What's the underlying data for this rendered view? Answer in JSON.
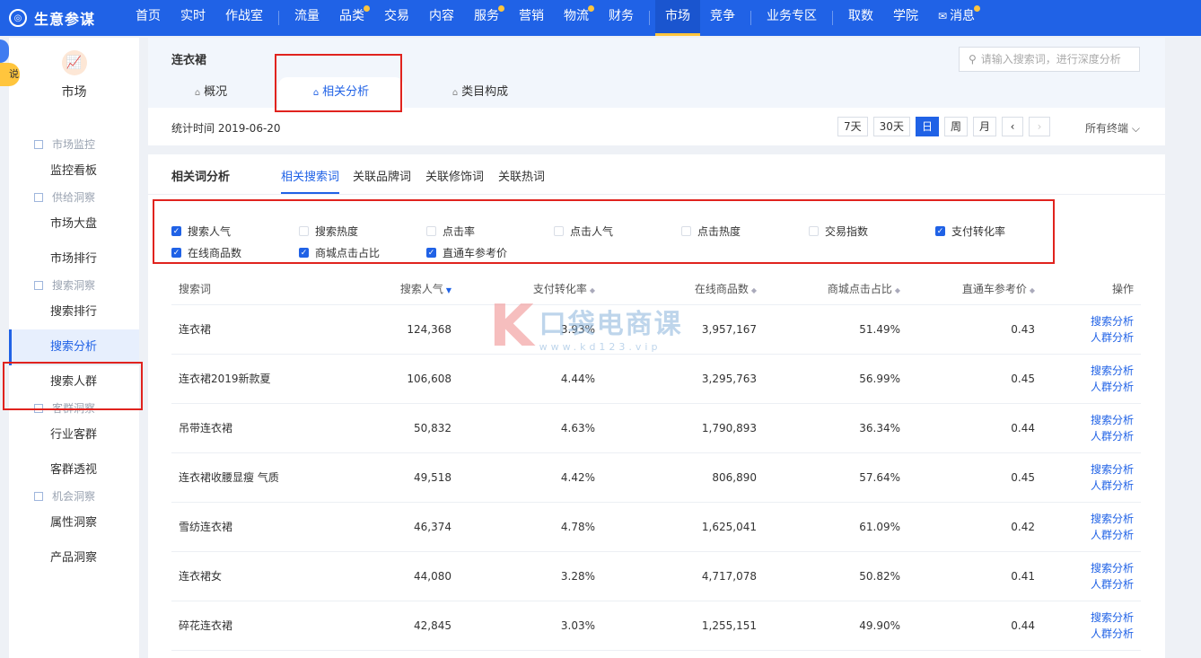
{
  "app": {
    "name": "生意参谋"
  },
  "topnav": {
    "groups": [
      [
        {
          "label": "首页",
          "dot": false
        },
        {
          "label": "实时",
          "dot": false
        },
        {
          "label": "作战室",
          "dot": false
        }
      ],
      [
        {
          "label": "流量",
          "dot": false
        },
        {
          "label": "品类",
          "dot": true
        },
        {
          "label": "交易",
          "dot": false
        },
        {
          "label": "内容",
          "dot": false
        },
        {
          "label": "服务",
          "dot": true
        },
        {
          "label": "营销",
          "dot": false
        },
        {
          "label": "物流",
          "dot": true
        },
        {
          "label": "财务",
          "dot": false
        }
      ],
      [
        {
          "label": "市场",
          "dot": false,
          "active": true
        },
        {
          "label": "竞争",
          "dot": false
        }
      ],
      [
        {
          "label": "业务专区",
          "dot": false
        }
      ],
      [
        {
          "label": "取数",
          "dot": false
        },
        {
          "label": "学院",
          "dot": false
        },
        {
          "label": "消息",
          "dot": true,
          "icon": "mail-icon"
        }
      ]
    ]
  },
  "sidebar": {
    "help_label": "说明",
    "head_label": "市场",
    "head_icon": "market-chart-icon",
    "groups": [
      {
        "title": "市场监控",
        "items": [
          "监控看板"
        ]
      },
      {
        "title": "供给洞察",
        "items": [
          "市场大盘",
          "市场排行"
        ]
      },
      {
        "title": "搜索洞察",
        "items": [
          "搜索排行",
          "搜索分析",
          "搜索人群"
        ]
      },
      {
        "title": "客群洞察",
        "items": [
          "行业客群",
          "客群透视"
        ]
      },
      {
        "title": "机会洞察",
        "items": [
          "属性洞察",
          "产品洞察"
        ]
      }
    ],
    "active_item": "搜索分析"
  },
  "header": {
    "category": "连衣裙",
    "search_placeholder": "请输入搜索词，进行深度分析",
    "tabs": [
      "概况",
      "相关分析",
      "类目构成"
    ],
    "active_tab": "相关分析",
    "stat_time": "统计时间 2019-06-20",
    "date_buttons": [
      "7天",
      "30天",
      "日",
      "周",
      "月"
    ],
    "active_date": "日",
    "terminal": "所有终端"
  },
  "analysis": {
    "title": "相关词分析",
    "subtabs": [
      "相关搜索词",
      "关联品牌词",
      "关联修饰词",
      "关联热词"
    ],
    "active_subtab": "相关搜索词",
    "metrics_row1": [
      {
        "label": "搜索人气",
        "checked": true
      },
      {
        "label": "搜索热度",
        "checked": false
      },
      {
        "label": "点击率",
        "checked": false
      },
      {
        "label": "点击人气",
        "checked": false
      },
      {
        "label": "点击热度",
        "checked": false
      },
      {
        "label": "交易指数",
        "checked": false
      },
      {
        "label": "支付转化率",
        "checked": true
      }
    ],
    "metrics_row2": [
      {
        "label": "在线商品数",
        "checked": true
      },
      {
        "label": "商城点击占比",
        "checked": true
      },
      {
        "label": "直通车参考价",
        "checked": true
      }
    ],
    "columns": [
      "搜索词",
      "搜索人气",
      "支付转化率",
      "在线商品数",
      "商城点击占比",
      "直通车参考价",
      "操作"
    ],
    "actions": [
      "搜索分析",
      "人群分析"
    ],
    "rows": [
      [
        "连衣裙",
        "124,368",
        "3.93%",
        "3,957,167",
        "51.49%",
        "0.43"
      ],
      [
        "连衣裙2019新款夏",
        "106,608",
        "4.44%",
        "3,295,763",
        "56.99%",
        "0.45"
      ],
      [
        "吊带连衣裙",
        "50,832",
        "4.63%",
        "1,790,893",
        "36.34%",
        "0.44"
      ],
      [
        "连衣裙收腰显瘦 气质",
        "49,518",
        "4.42%",
        "806,890",
        "57.64%",
        "0.45"
      ],
      [
        "雪纺连衣裙",
        "46,374",
        "4.78%",
        "1,625,041",
        "61.09%",
        "0.42"
      ],
      [
        "连衣裙女",
        "44,080",
        "3.28%",
        "4,717,078",
        "50.82%",
        "0.41"
      ],
      [
        "碎花连衣裙",
        "42,845",
        "3.03%",
        "1,255,151",
        "49.90%",
        "0.44"
      ]
    ]
  },
  "watermark": {
    "letter": "K",
    "name": "口袋电商课",
    "url": "www.kd123.vip"
  },
  "colors": {
    "primary": "#2062e6",
    "highlight": "#e0231e",
    "dot": "#ffc53d"
  }
}
